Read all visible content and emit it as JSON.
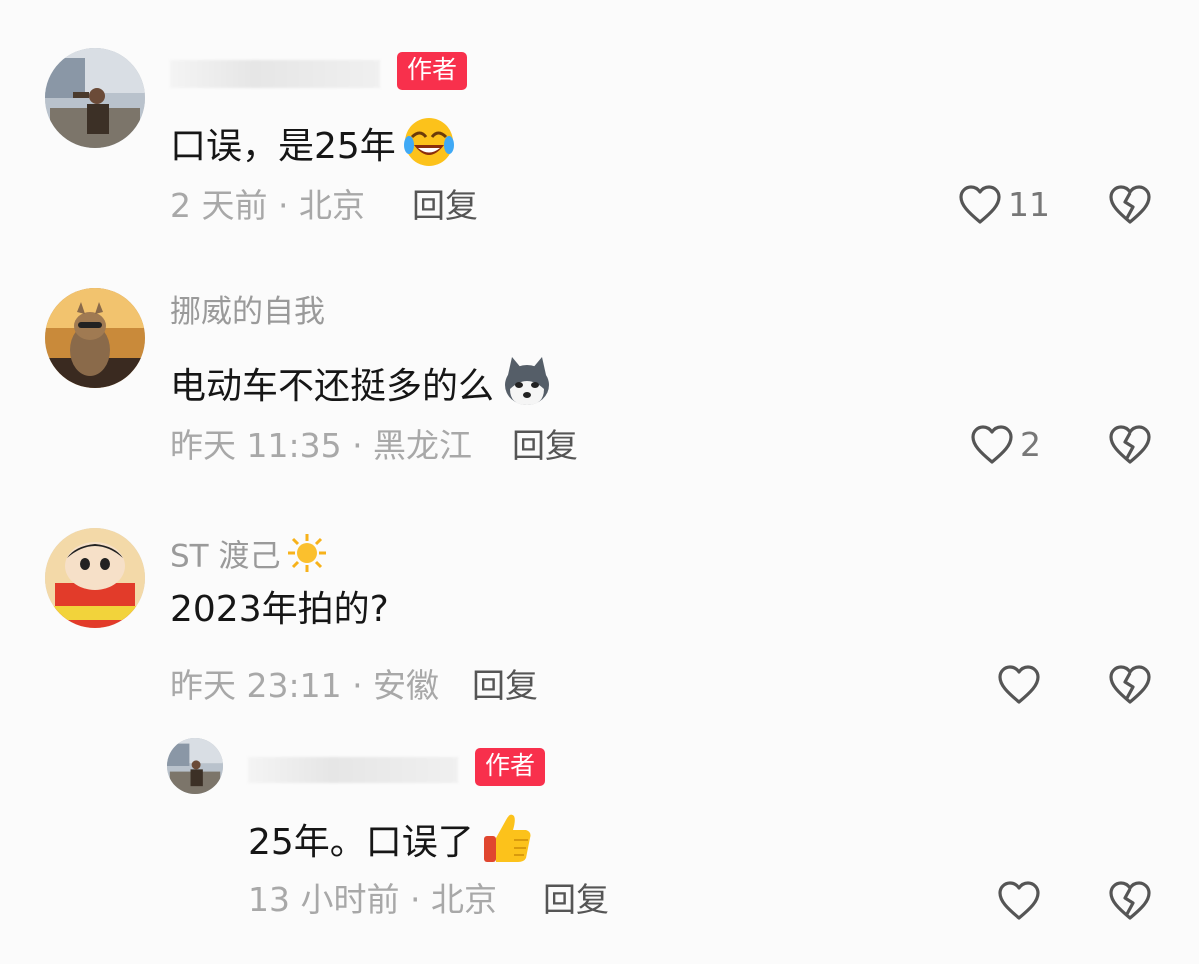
{
  "comments": [
    {
      "name": "",
      "badge": "作者",
      "text": "口误，是25年",
      "emoji": "rolling-laughing-emoji",
      "time": "2 天前 · 北京",
      "reply": "回复",
      "likes": "11"
    },
    {
      "name": "挪威的自我",
      "text": "电动车不还挺多的么",
      "emoji": "husky-dog-emoji",
      "time": "昨天 11:35 · 黑龙江",
      "reply": "回复",
      "likes": "2"
    },
    {
      "name": "ST 渡己",
      "name_emoji": "sun-emoji",
      "text": "2023年拍的?",
      "time": "昨天 23:11 · 安徽",
      "reply": "回复",
      "likes": ""
    }
  ],
  "reply": {
    "name": "",
    "badge": "作者",
    "text": "25年。口误了",
    "emoji": "thumbs-up-emoji",
    "time": "13 小时前 · 北京",
    "reply": "回复",
    "likes": ""
  },
  "colors": {
    "badge": "#f8304c",
    "meta": "#a8a8a8",
    "text": "#161616",
    "icon": "#555555"
  }
}
